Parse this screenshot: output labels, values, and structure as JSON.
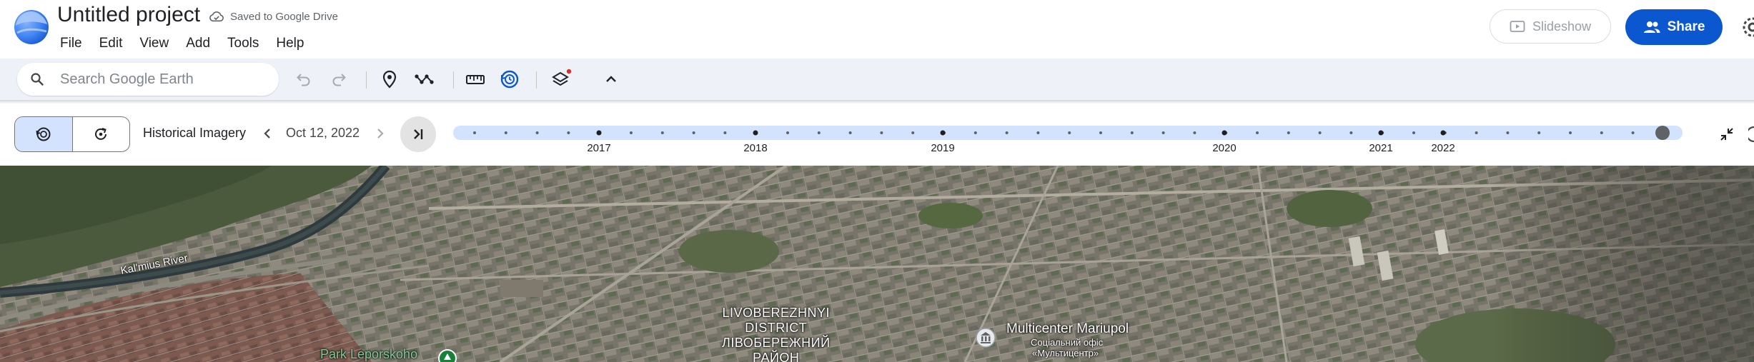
{
  "header": {
    "title": "Untitled project",
    "save_status": "Saved to Google Drive",
    "menu": [
      "File",
      "Edit",
      "View",
      "Add",
      "Tools",
      "Help"
    ],
    "slideshow_label": "Slideshow",
    "share_label": "Share"
  },
  "toolbar": {
    "search_placeholder": "Search Google Earth",
    "tools": [
      "undo-icon",
      "redo-icon",
      "placemark-icon",
      "path-icon",
      "measure-icon",
      "historical-imagery-icon",
      "layers-icon",
      "collapse-toolbar-icon"
    ]
  },
  "history": {
    "label": "Historical Imagery",
    "date": "Oct 12, 2022",
    "timeline_years": [
      "2017",
      "2018",
      "2019",
      "2020",
      "2021",
      "2022"
    ]
  },
  "map": {
    "labels": {
      "river": "Kal'mius River",
      "district_line1": "LIVOBEREZHNYI",
      "district_line2": "DISTRICT",
      "district_line3": "ЛІВОБЕРЕЖНИЙ",
      "district_line4": "РАЙОН",
      "poi_name": "Multicenter Mariupol",
      "poi_sub1": "Соціальний офіс",
      "poi_sub2": "«Мультицентр»",
      "park": "Park Leporskoho"
    }
  },
  "colors": {
    "primary": "#0b57d0",
    "toolbar_bg": "#eef2f8",
    "timeline_track": "#d3e3fd",
    "active_segment": "#d3e3fd",
    "notification_dot": "#d93025",
    "park_marker": "#188038"
  }
}
